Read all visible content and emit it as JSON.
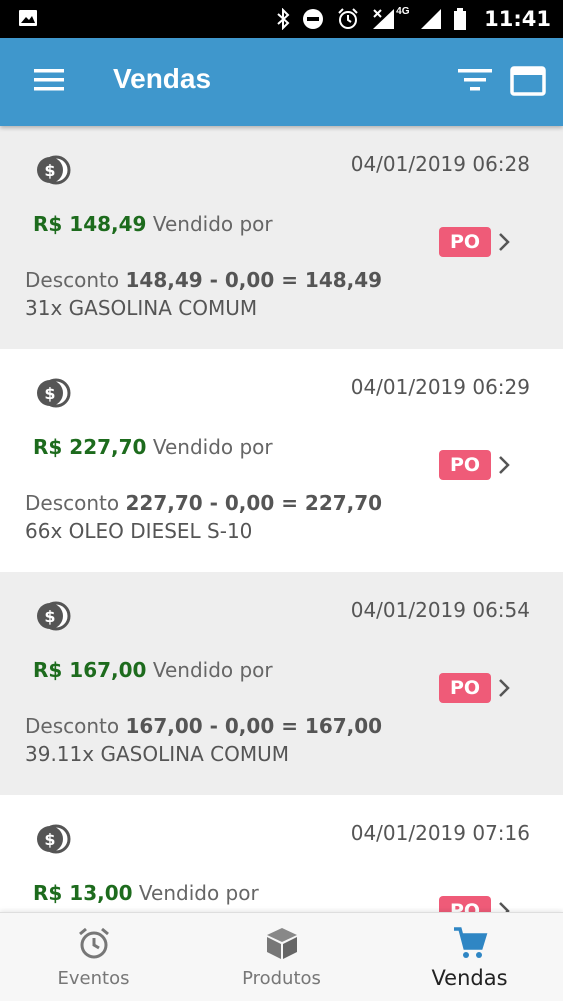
{
  "status_bar": {
    "time": "11:41",
    "network": "4G",
    "icons": [
      "image-icon",
      "bluetooth-icon",
      "do-not-disturb-icon",
      "alarm-icon",
      "signal-icon",
      "battery-icon"
    ]
  },
  "app_bar": {
    "title": "Vendas",
    "icons": [
      "menu-icon",
      "filter-icon",
      "window-icon"
    ]
  },
  "sales": [
    {
      "datetime": "04/01/2019 06:28",
      "amount": "R$ 148,49",
      "sold_by": "Vendido por",
      "badge": "PO",
      "discount_label": "Desconto",
      "discount_calc": "148,49 - 0,00 = 148,49",
      "product": "31x GASOLINA COMUM"
    },
    {
      "datetime": "04/01/2019 06:29",
      "amount": "R$ 227,70",
      "sold_by": "Vendido por",
      "badge": "PO",
      "discount_label": "Desconto",
      "discount_calc": "227,70 - 0,00 = 227,70",
      "product": "66x OLEO DIESEL S-10"
    },
    {
      "datetime": "04/01/2019 06:54",
      "amount": "R$ 167,00",
      "sold_by": "Vendido por",
      "badge": "PO",
      "discount_label": "Desconto",
      "discount_calc": "167,00 - 0,00 = 167,00",
      "product": "39.11x GASOLINA COMUM"
    },
    {
      "datetime": "04/01/2019 07:16",
      "amount": "R$ 13,00",
      "sold_by": "Vendido por",
      "badge": "PO",
      "discount_label": "",
      "discount_calc": "",
      "product": ""
    }
  ],
  "bottom_nav": {
    "items": [
      {
        "label": "Eventos",
        "icon": "alarm-clock-icon"
      },
      {
        "label": "Produtos",
        "icon": "box-icon"
      },
      {
        "label": "Vendas",
        "icon": "shopping-cart-icon",
        "active": true
      }
    ]
  },
  "colors": {
    "app_bar": "#3f97cc",
    "amount": "#1d6b1d",
    "badge": "#ef5b78",
    "active_nav_icon": "#2f86c4"
  }
}
